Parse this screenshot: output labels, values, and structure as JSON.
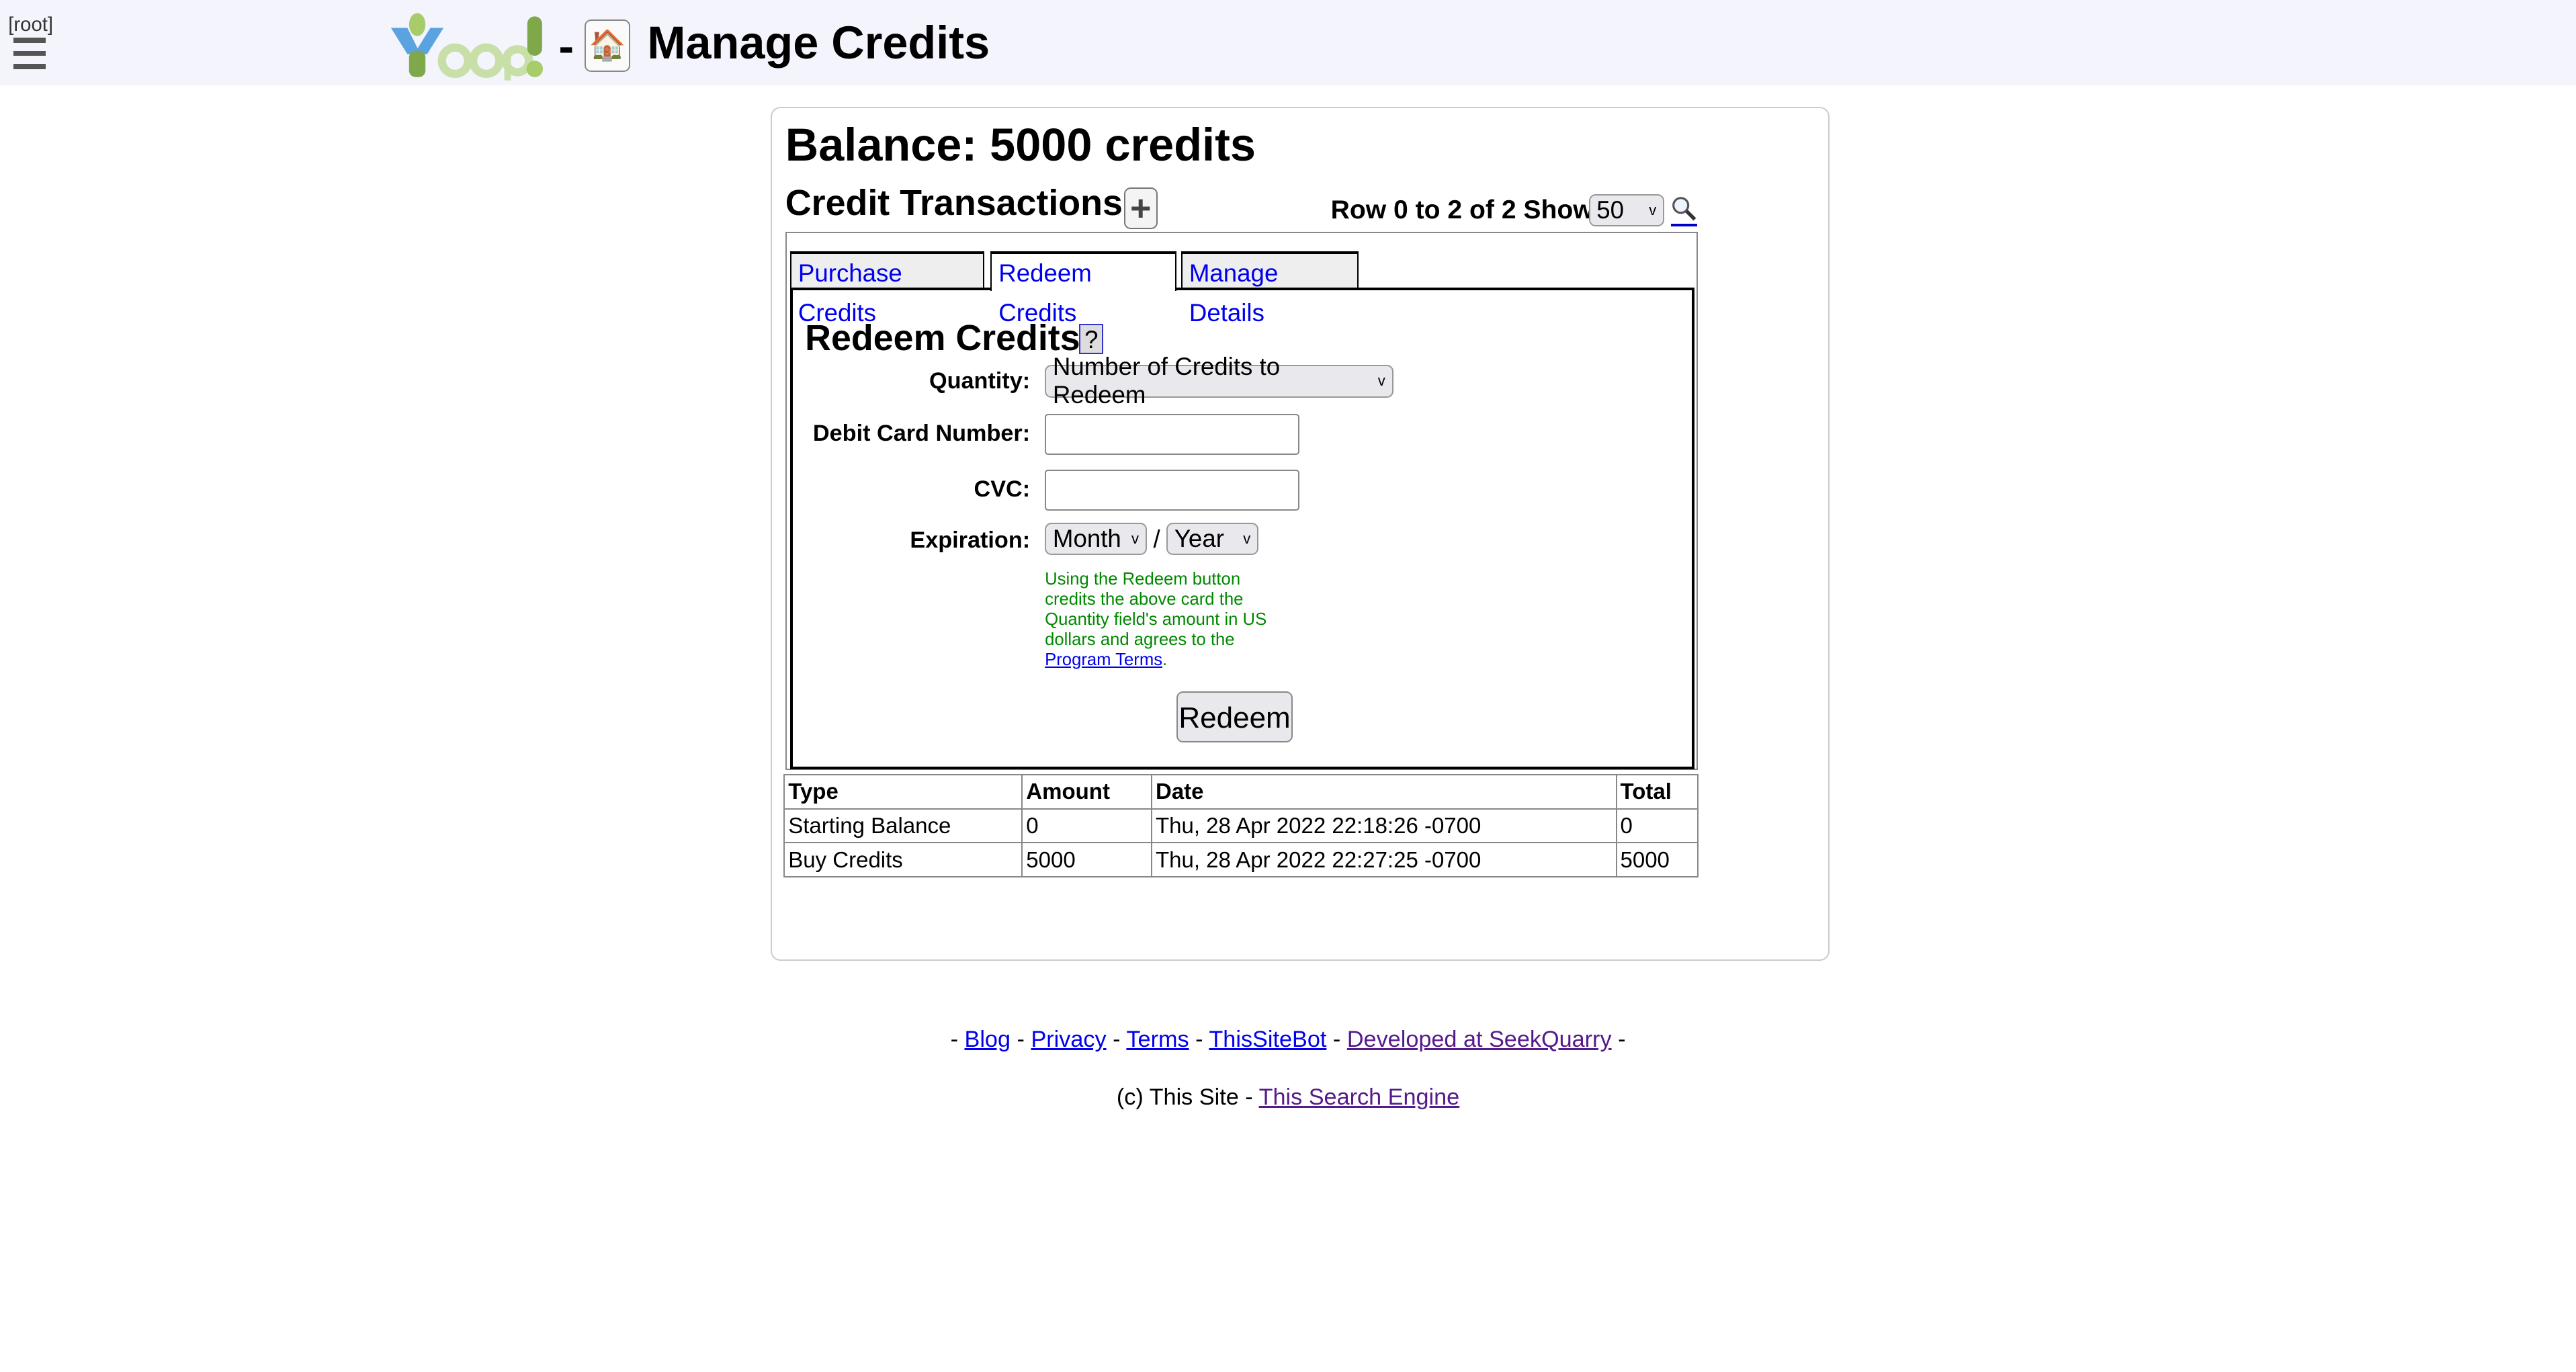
{
  "header": {
    "root_label": "[root]",
    "logo_text": "Yoop!",
    "separator": "-",
    "home_icon": "house",
    "title": "Manage Credits"
  },
  "balance": "Balance: 5000 credits",
  "transactions": {
    "heading": "Credit Transactions",
    "add_icon": "plus",
    "row_info": "Row 0 to 2 of 2 Show",
    "show_value": "50",
    "search_icon": "magnifier"
  },
  "tabs": [
    {
      "label": "Purchase Credits"
    },
    {
      "label": "Redeem Credits",
      "active": true
    },
    {
      "label": "Manage Details"
    }
  ],
  "redeem": {
    "heading": "Redeem Credits",
    "help": "?",
    "quantity_label": "Quantity:",
    "quantity_value": "Number of Credits to Redeem",
    "card_label": "Debit Card Number:",
    "card_value": "",
    "cvc_label": "CVC:",
    "cvc_value": "",
    "exp_label": "Expiration:",
    "month": "Month",
    "slash": "/",
    "year": "Year",
    "note": "Using the Redeem button credits the above card the Quantity field's amount in US dollars and agrees to the ",
    "terms_link": "Program Terms",
    "note_end": ".",
    "button": "Redeem"
  },
  "table": {
    "headers": [
      "Type",
      "Amount",
      "Date",
      "Total"
    ],
    "rows": [
      [
        "Starting Balance",
        "0",
        "Thu, 28 Apr 2022 22:18:26 -0700",
        "0"
      ],
      [
        "Buy Credits",
        "5000",
        "Thu, 28 Apr 2022 22:27:25 -0700",
        "5000"
      ]
    ]
  },
  "footer": {
    "links": [
      "Blog",
      "Privacy",
      "Terms",
      "ThisSiteBot",
      "Developed at SeekQuarry"
    ],
    "sep": "-",
    "copyright": "(c) This Site -",
    "engine_link": "This Search Engine"
  },
  "colors": {
    "header_bg": "#f4f4fd",
    "link": "#0000ee",
    "visited": "#551a8b",
    "note": "#008000"
  }
}
